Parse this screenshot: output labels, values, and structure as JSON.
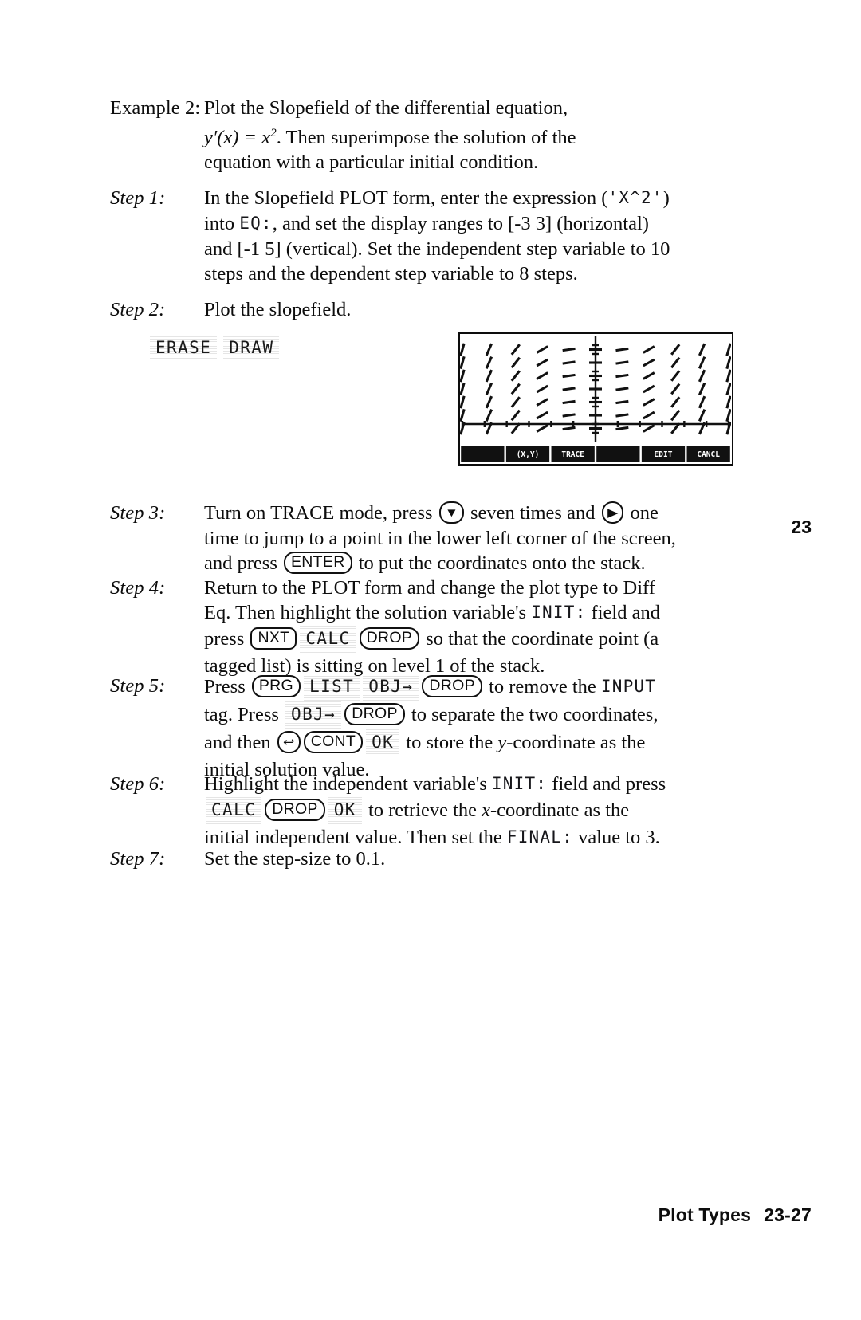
{
  "example": {
    "label": "Example 2:",
    "lines": [
      "Plot the Slopefield of the differential equation,",
      "y'(x) = x2. Then superimpose the solution of the",
      "equation with a particular initial condition."
    ],
    "line2_prefix": "y",
    "line2_prime": "′",
    "line2_arg": "(x) = x",
    "line2_exp": "2",
    "line2_rest": ". Then superimpose the solution of the"
  },
  "step1": {
    "label": "Step 1:",
    "l1_a": "In the Slopefield PLOT form, enter the expression (",
    "l1_lcd": "'X^2'",
    "l1_b": ")",
    "l2_a": "into ",
    "l2_lcd": "EQ:",
    "l2_b": ", and set the display ranges to [-3 3] (horizontal)",
    "l3": "and [-1 5] (vertical). Set the independent step variable to 10",
    "l4": "steps and the dependent step variable to 8 steps."
  },
  "step2": {
    "label": "Step 2:",
    "text": "Plot the slopefield.",
    "menu_erase": "ERASE",
    "menu_draw": "DRAW"
  },
  "plot": {
    "softkeys": [
      "",
      "(X,Y)",
      "TRACE",
      "",
      "EDIT",
      "CANCL"
    ],
    "xlim": [
      -3,
      3
    ],
    "ylim": [
      -1,
      5
    ],
    "xsteps": 10,
    "ysteps": 8,
    "equation": "y'(x) = x^2"
  },
  "step3": {
    "label": "Step 3:",
    "l1_a": "Turn on TRACE mode, press ",
    "l1_key_down": "▼",
    "l1_b": " seven times and ",
    "l1_key_right": "▶",
    "l1_c": " one",
    "l2": "time to jump to a point in the lower left corner of the screen,",
    "l3_a": "and press ",
    "l3_key": "ENTER",
    "l3_b": " to put the coordinates onto the stack."
  },
  "step4": {
    "label": "Step 4:",
    "l1": "Return to the PLOT form and change the plot type to Diff",
    "l2_a": "Eq. Then highlight the solution variable's ",
    "l2_lcd": "INIT:",
    "l2_b": " field and",
    "l3_a": "press ",
    "l3_key_nxt": "NXT",
    "l3_soft_calc": "CALC",
    "l3_key_drop": "DROP",
    "l3_b": " so that the coordinate point (a",
    "l4": "tagged list) is sitting on level 1 of the stack."
  },
  "step5": {
    "label": "Step 5:",
    "l1_a": "Press ",
    "l1_key_prg": "PRG",
    "l1_soft_list": "LIST",
    "l1_soft_obj": "OBJ→",
    "l1_key_drop": "DROP",
    "l1_b": " to remove the ",
    "l1_lcd": "INPUT",
    "l2_a": "tag. Press ",
    "l2_soft_obj": "OBJ→",
    "l2_key_drop": "DROP",
    "l2_b": " to separate the two coordinates,",
    "l3_a": "and then ",
    "l3_key_back": "↩",
    "l3_key_cont": "CONT",
    "l3_soft_ok": "OK",
    "l3_b": " to store the y-coordinate as the",
    "l4": "initial solution value."
  },
  "step6": {
    "label": "Step 6:",
    "l1_a": "Highlight the independent variable's ",
    "l1_lcd": "INIT:",
    "l1_b": " field and press",
    "l2_soft_calc": "CALC",
    "l2_key_drop": "DROP",
    "l2_soft_ok": "OK",
    "l2_b": " to retrieve the x-coordinate as the",
    "l3_a": "initial independent value. Then set the ",
    "l3_lcd": "FINAL:",
    "l3_b": " value to 3."
  },
  "step7": {
    "label": "Step 7:",
    "text": "Set the step-size to 0.1."
  },
  "margin": {
    "chapter_number": "23"
  },
  "footer": {
    "title": "Plot Types",
    "page": "23-27"
  }
}
